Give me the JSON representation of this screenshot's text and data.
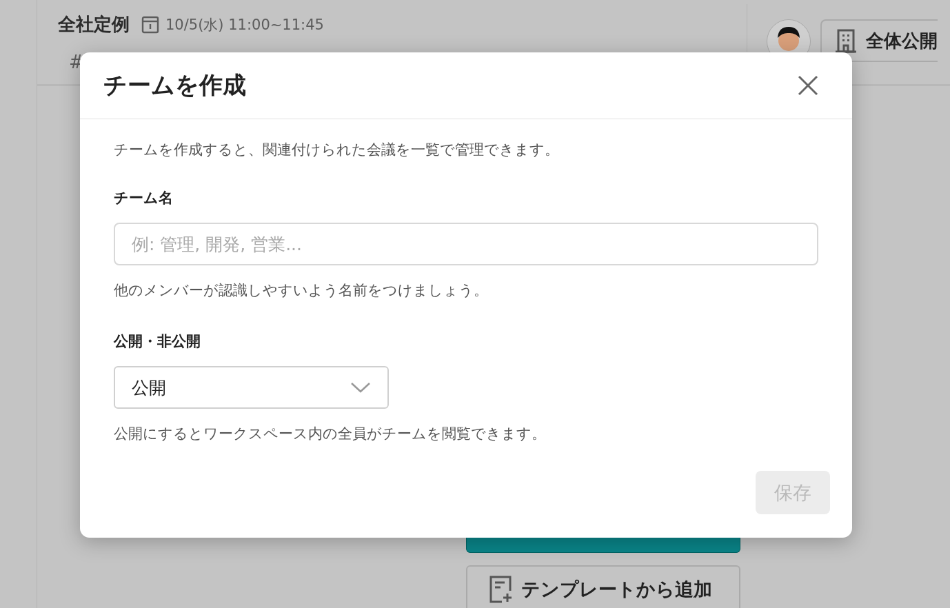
{
  "header": {
    "title": "全社定例",
    "datetime": "10/5(水) 11:00~11:45",
    "tag_mark": "#",
    "visibility_button": "全体公開"
  },
  "background_actions": {
    "template_button": "テンプレートから追加"
  },
  "dialog": {
    "title": "チームを作成",
    "description": "チームを作成すると、関連付けられた会議を一覧で管理できます。",
    "fields": [
      {
        "kind": "text",
        "label": "チーム名",
        "placeholder": "例: 管理, 開発, 営業...",
        "help": "他のメンバーが認識しやすいよう名前をつけましょう。"
      },
      {
        "kind": "select",
        "label": "公開・非公開",
        "value": "公開",
        "help": "公開にするとワークスペース内の全員がチームを閲覧できます。"
      }
    ],
    "save_button": {
      "label": "保存",
      "disabled": true
    }
  }
}
